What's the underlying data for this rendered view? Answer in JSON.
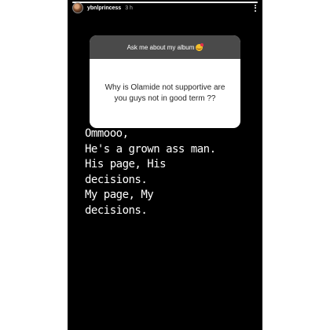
{
  "story": {
    "progress_fraction": 1.0,
    "username": "ybnlprincess",
    "time": "3 h"
  },
  "question_box": {
    "header": "Ask me about my album",
    "header_emoji_icon": "smiling-face-with-hearts-icon",
    "question": "Why is Olamide not supportive are you guys not in good term ??"
  },
  "answer": {
    "lines": [
      "Ommooo,",
      "He's a grown ass man.",
      "His page, His",
      "decisions.",
      "My page, My",
      "decisions."
    ]
  }
}
